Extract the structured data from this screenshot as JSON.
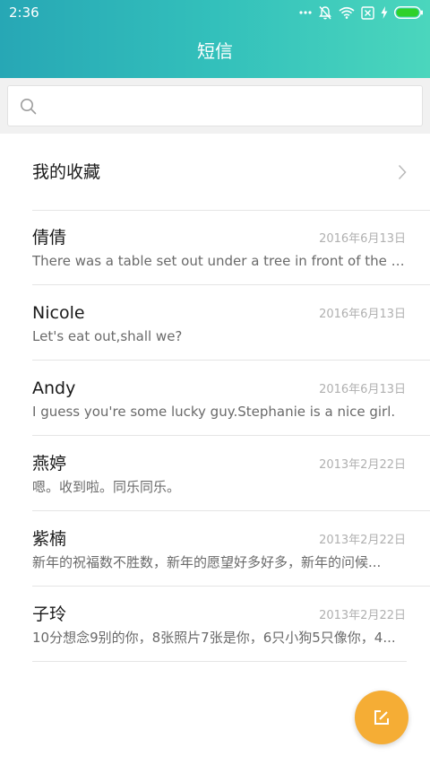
{
  "status_bar": {
    "time": "2:36",
    "icons": [
      "more-dots-icon",
      "notifications-off-icon",
      "wifi-icon",
      "no-sim-icon",
      "charging-icon",
      "battery-icon"
    ]
  },
  "header": {
    "title": "短信",
    "gradient_start": "#27a7b5",
    "gradient_end": "#4bd6bd"
  },
  "search": {
    "placeholder": "",
    "value": ""
  },
  "favorites": {
    "label": "我的收藏"
  },
  "messages": [
    {
      "name": "倩倩",
      "date": "2016年6月13日",
      "preview": "There was a table set out under a tree in front of the ho..."
    },
    {
      "name": "Nicole",
      "date": "2016年6月13日",
      "preview": "Let's eat out,shall we?"
    },
    {
      "name": "Andy",
      "date": "2016年6月13日",
      "preview": "I guess you're some lucky guy.Stephanie is a nice girl."
    },
    {
      "name": "燕婷",
      "date": "2013年2月22日",
      "preview": "嗯。收到啦。同乐同乐。"
    },
    {
      "name": "紫楠",
      "date": "2013年2月22日",
      "preview": "新年的祝福数不胜数，新年的愿望好多好多，新年的问候..."
    },
    {
      "name": "子玲",
      "date": "2013年2月22日",
      "preview": "10分想念9别的你，8张照片7张是你，6只小狗5只像你，4..."
    }
  ],
  "fab": {
    "icon": "compose-icon",
    "color": "#f5ad35"
  }
}
